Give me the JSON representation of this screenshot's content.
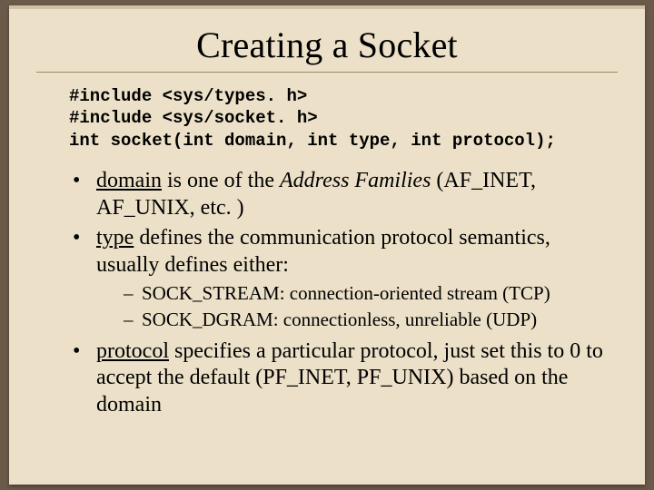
{
  "title": "Creating a Socket",
  "code": {
    "l1": "#include <sys/types. h>",
    "l2": "#include <sys/socket. h>",
    "l3": "int socket(int domain, int type, int protocol);"
  },
  "bul1": {
    "w1": "domain",
    "t1": " is one of the ",
    "w2": "Address Families",
    "t2": " (AF_INET, AF_UNIX, etc. )"
  },
  "bul2": {
    "w1": "type",
    "t1": " defines the communication protocol semantics, usually defines either:"
  },
  "sub1": "SOCK_STREAM:  connection-oriented stream (TCP)",
  "sub2": "SOCK_DGRAM:    connectionless, unreliable (UDP)",
  "bul3": {
    "w1": "protocol",
    "t1": " specifies a particular protocol, just set this to 0 to accept the default (PF_INET, PF_UNIX) based on the domain"
  }
}
